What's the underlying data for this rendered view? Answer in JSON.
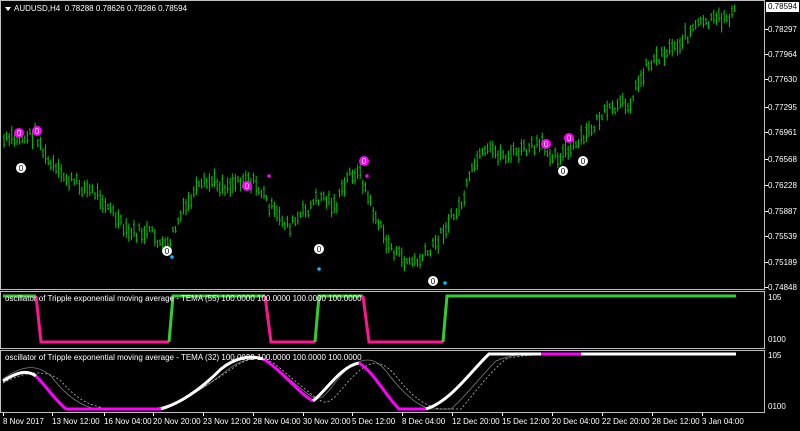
{
  "header": {
    "symbol": "AUDUSD,H4",
    "quotes": "0.78288 0.78626 0.78286 0.78594"
  },
  "current_price": "0.78594",
  "price_axis": [
    "0.78297",
    "0.77964",
    "0.77630",
    "0.77295",
    "0.76961",
    "0.76568",
    "0.76228",
    "0.75887",
    "0.75539",
    "0.75189",
    "0.74848"
  ],
  "osc1": {
    "title": "oscillator of Tripple exponential moving average - TEMA (55) 100.0000 100.0000 100.0000 100.0000",
    "axis": [
      "105",
      "0100"
    ]
  },
  "osc2": {
    "title": "oscillator of Tripple exponential moving average - TEMA (32) 100.0000 100.0000 100.0000 100.0000",
    "axis": [
      "105",
      "0100"
    ]
  },
  "time_axis": [
    "8 Nov 2017",
    "13 Nov 12:00",
    "16 Nov 04:00",
    "20 Nov 20:00",
    "23 Nov 12:00",
    "28 Nov 04:00",
    "30 Nov 20:00",
    "5 Dec 12:00",
    "8 Dec 04:00",
    "12 Dec 20:00",
    "15 Dec 12:00",
    "20 Dec 04:00",
    "22 Dec 20:00",
    "28 Dec 12:00",
    "3 Jan 04:00"
  ],
  "markers": {
    "zero_label": "0"
  },
  "colors": {
    "candles": "#00c800",
    "up_marker": "#ff00ff",
    "down_marker": "#ffffff",
    "dot_cyan": "#00bfff",
    "osc_green": "#32cd32",
    "osc_magenta": "#ff1493"
  }
}
